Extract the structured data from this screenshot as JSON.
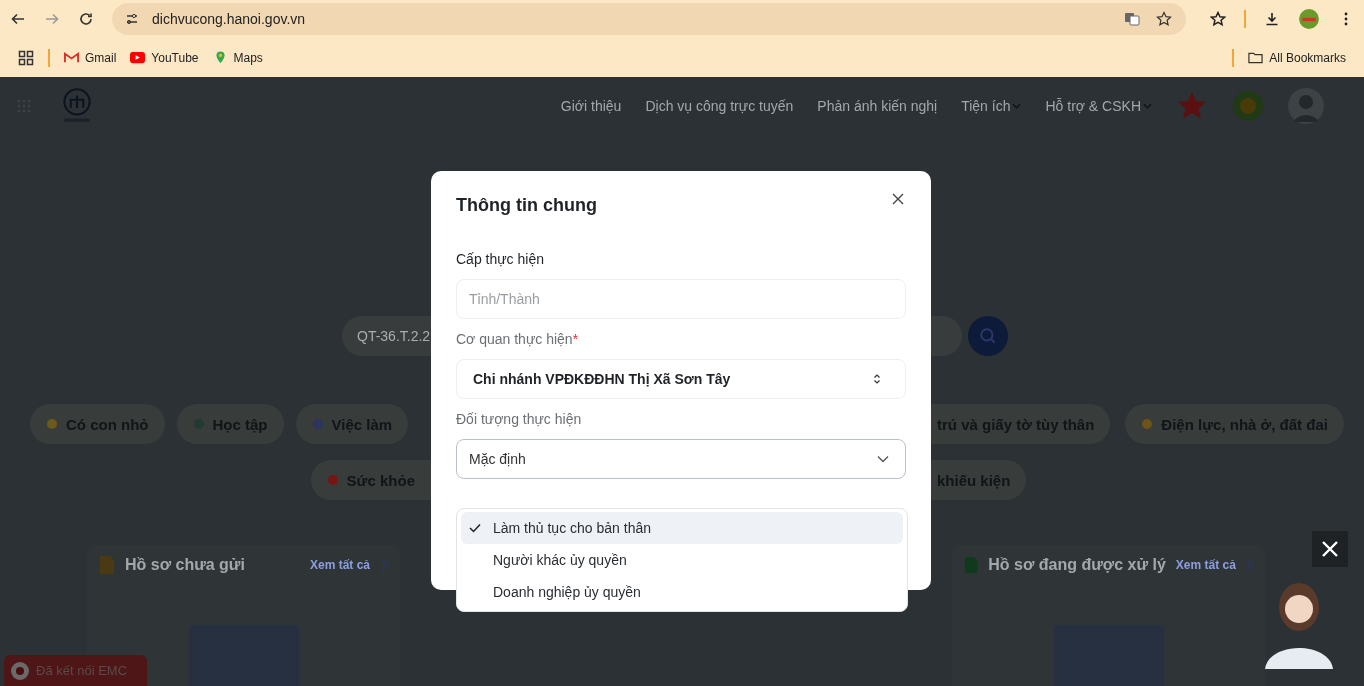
{
  "browser": {
    "url": "dichvucong.hanoi.gov.vn",
    "bookmarks": [
      "Gmail",
      "YouTube",
      "Maps"
    ],
    "all_bookmarks": "All Bookmarks"
  },
  "header": {
    "nav": [
      {
        "label": "Giới thiệu",
        "dropdown": false
      },
      {
        "label": "Dịch vụ công trực tuyến",
        "dropdown": false
      },
      {
        "label": "Phản ánh kiến nghị",
        "dropdown": false
      },
      {
        "label": "Tiện ích",
        "dropdown": true
      },
      {
        "label": "Hỗ trợ & CSKH",
        "dropdown": true
      }
    ]
  },
  "search": {
    "value": "QT-36.T.2.2"
  },
  "chip_rows": [
    {
      "left": [
        {
          "label": "Có con nhỏ",
          "kind": "child"
        },
        {
          "label": "Học tập",
          "kind": "education"
        },
        {
          "label": "Việc làm",
          "kind": "work"
        }
      ],
      "right": [
        {
          "label": "trú và giấy tờ tùy thân",
          "kind": "none"
        },
        {
          "label": "Điện lực, nhà ở, đất đai",
          "kind": "home"
        }
      ]
    },
    {
      "left": [
        {
          "label": "Sức khỏe",
          "kind": "health"
        }
      ],
      "right": [
        {
          "label": "khiếu kiện",
          "kind": "none"
        }
      ]
    }
  ],
  "cards": [
    {
      "title": "Hồ sơ chưa gửi",
      "link": "Xem tất cả",
      "kind": "draft"
    },
    {
      "title": "Hồ sơ đang được xử lý",
      "link": "Xem tất cả",
      "kind": "sheet"
    }
  ],
  "modal": {
    "title": "Thông tin chung",
    "fields": [
      {
        "label": "Cấp thực hiện",
        "kind": "input",
        "placeholder": "Tỉnh/Thành"
      },
      {
        "label": "Cơ quan thực hiện",
        "required_mark": "*",
        "kind": "select",
        "value": "Chi nhánh VPĐKĐĐHN Thị Xã Sơn Tây"
      },
      {
        "label": "Đối tượng thực hiện",
        "kind": "dropdown",
        "value": "Mặc định",
        "expanded": true
      }
    ],
    "options": [
      {
        "label": "Làm thủ tục cho bản thân",
        "selected": true
      },
      {
        "label": "Người khác ủy quyền",
        "selected": false
      },
      {
        "label": "Doanh nghiệp ủy quyền",
        "selected": false
      }
    ]
  },
  "status_badge": "Đã kết nối EMC"
}
